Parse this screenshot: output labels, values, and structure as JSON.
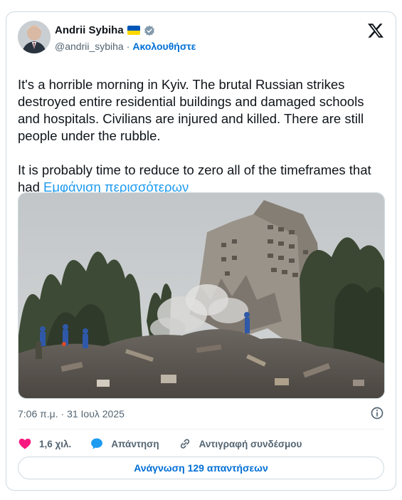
{
  "author": {
    "name": "Andrii Sybiha",
    "handle": "@andrii_sybiha",
    "separator": "·",
    "follow_label": "Ακολουθήστε",
    "flag": "ukraine-flag",
    "verified": true
  },
  "tweet": {
    "paragraph_1": "It's a horrible morning in Kyiv. The brutal Russian strikes destroyed entire residential buildings and damaged schools and hospitals. Civilians are injured and killed. There are still people under the rubble.",
    "paragraph_2_text": "It is probably time to reduce to zero all of the timeframes that had ",
    "show_more_label": "Εμφάνιση περισσότερων",
    "image_icon": "collapsed-apartment-building-photo"
  },
  "meta": {
    "timestamp": "7:06 π.μ. · 31 Ιουλ 2025"
  },
  "actions": {
    "likes_count": "1,6 χιλ.",
    "reply_label": "Απάντηση",
    "copy_link_label": "Αντιγραφή συνδέσμου"
  },
  "footer": {
    "read_replies_label": "Ανάγνωση 129 απαντήσεων"
  },
  "colors": {
    "link": "#1d9bf0",
    "follow": "#006fd6",
    "like": "#f91880",
    "reply": "#1d9bf0",
    "muted": "#536471",
    "border": "#cfd9de"
  }
}
